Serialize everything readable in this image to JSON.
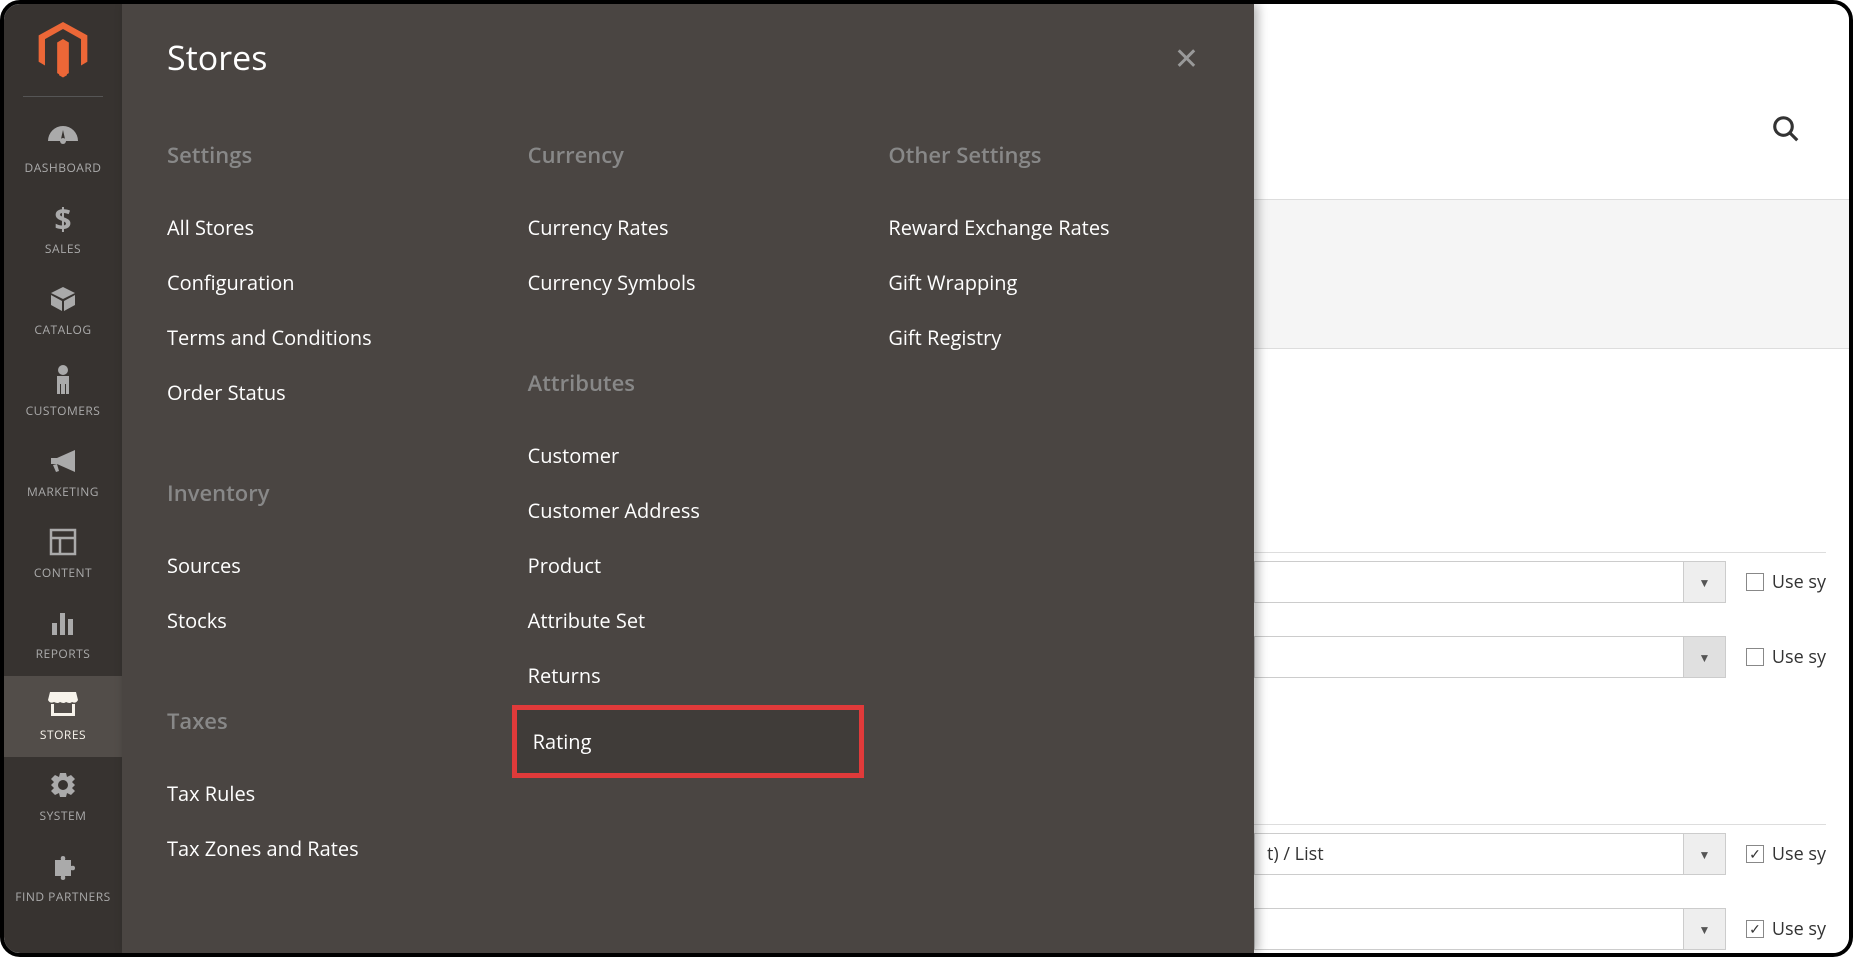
{
  "sidebar": {
    "items": [
      {
        "label": "DASHBOARD",
        "icon": "gauge"
      },
      {
        "label": "SALES",
        "icon": "dollar"
      },
      {
        "label": "CATALOG",
        "icon": "box"
      },
      {
        "label": "CUSTOMERS",
        "icon": "person"
      },
      {
        "label": "MARKETING",
        "icon": "megaphone"
      },
      {
        "label": "CONTENT",
        "icon": "layout"
      },
      {
        "label": "REPORTS",
        "icon": "bars"
      },
      {
        "label": "STORES",
        "icon": "storefront"
      },
      {
        "label": "SYSTEM",
        "icon": "gear"
      },
      {
        "label": "FIND PARTNERS",
        "icon": "puzzle"
      }
    ]
  },
  "flyout": {
    "title": "Stores",
    "col1": {
      "settings_title": "Settings",
      "settings": [
        "All Stores",
        "Configuration",
        "Terms and Conditions",
        "Order Status"
      ],
      "inventory_title": "Inventory",
      "inventory": [
        "Sources",
        "Stocks"
      ],
      "taxes_title": "Taxes",
      "taxes": [
        "Tax Rules",
        "Tax Zones and Rates"
      ]
    },
    "col2": {
      "currency_title": "Currency",
      "currency": [
        "Currency Rates",
        "Currency Symbols"
      ],
      "attributes_title": "Attributes",
      "attributes": [
        "Customer",
        "Customer Address",
        "Product",
        "Attribute Set",
        "Returns",
        "Rating"
      ]
    },
    "col3": {
      "other_title": "Other Settings",
      "other": [
        "Reward Exchange Rates",
        "Gift Wrapping",
        "Gift Registry"
      ]
    }
  },
  "bg": {
    "select_text": "t) / List",
    "use_label": "Use sy"
  }
}
